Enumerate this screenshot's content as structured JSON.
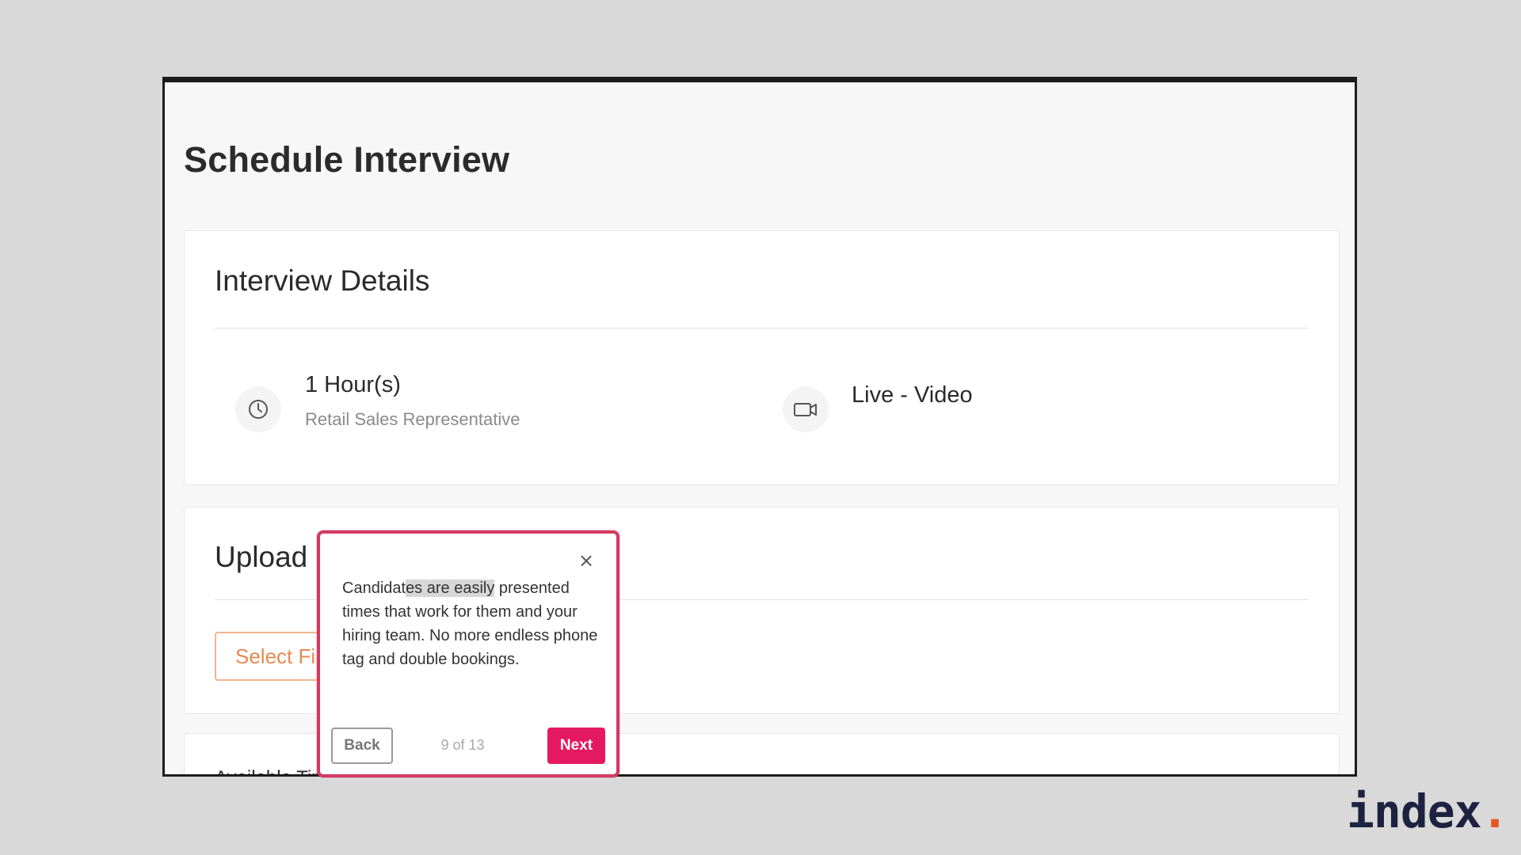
{
  "page": {
    "title": "Schedule Interview"
  },
  "interview_details": {
    "heading": "Interview Details",
    "duration": "1 Hour(s)",
    "job_title": "Retail Sales Representative",
    "type": "Live - Video",
    "icons": {
      "duration": "clock-icon",
      "type": "video-camera-icon"
    }
  },
  "upload": {
    "heading_visible": "Upload I",
    "select_button_visible": "Select Fi"
  },
  "availability": {
    "heading_visible": "Available Times"
  },
  "tour": {
    "text_before_highlight": "Candidat",
    "text_highlight": "es are easily",
    "text_after_highlight": " presented times that work for them and your hiring team. No more endless phone tag and double bookings.",
    "close_label": "×",
    "back_label": "Back",
    "progress": "9 of 13",
    "next_label": "Next",
    "accent_color": "#e5195f"
  },
  "brand": {
    "name": "index",
    "dot": ".",
    "dot_color": "#e5571e"
  }
}
